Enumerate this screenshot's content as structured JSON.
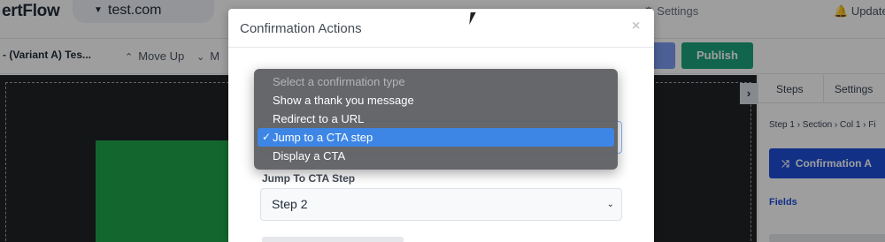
{
  "app": {
    "brand": "ertFlow",
    "site": "test.com",
    "nav_tabs": [
      "Settings"
    ],
    "updates_label": "Updates"
  },
  "toolbar": {
    "variant_title": "- (Variant A) Tes...",
    "move_up_label": "Move Up",
    "move_down_label": "M",
    "publish_label": "Publish"
  },
  "right_panel": {
    "tabs": [
      "Steps",
      "Settings"
    ],
    "breadcrumb": "Step 1 › Section › Col 1 › Fi",
    "action_button_label": "Confirmation A",
    "fields_heading": "Fields"
  },
  "modal": {
    "title": "Confirmation Actions",
    "close_glyph": "×",
    "jump_label": "Jump To CTA Step",
    "jump_value": "Step 2"
  },
  "confirmation_type_dropdown": {
    "options": [
      "Select a confirmation type",
      "Show a thank you message",
      "Redirect to a URL",
      "Jump to a CTA step",
      "Display a CTA"
    ],
    "selected_option": "Jump to a CTA step",
    "check_glyph": "✓"
  },
  "colors": {
    "publish_green": "#1aa37b",
    "primary_blue": "#1d4ed8",
    "highlight_blue": "#3d86e6",
    "canvas_green": "#1fa64b"
  }
}
